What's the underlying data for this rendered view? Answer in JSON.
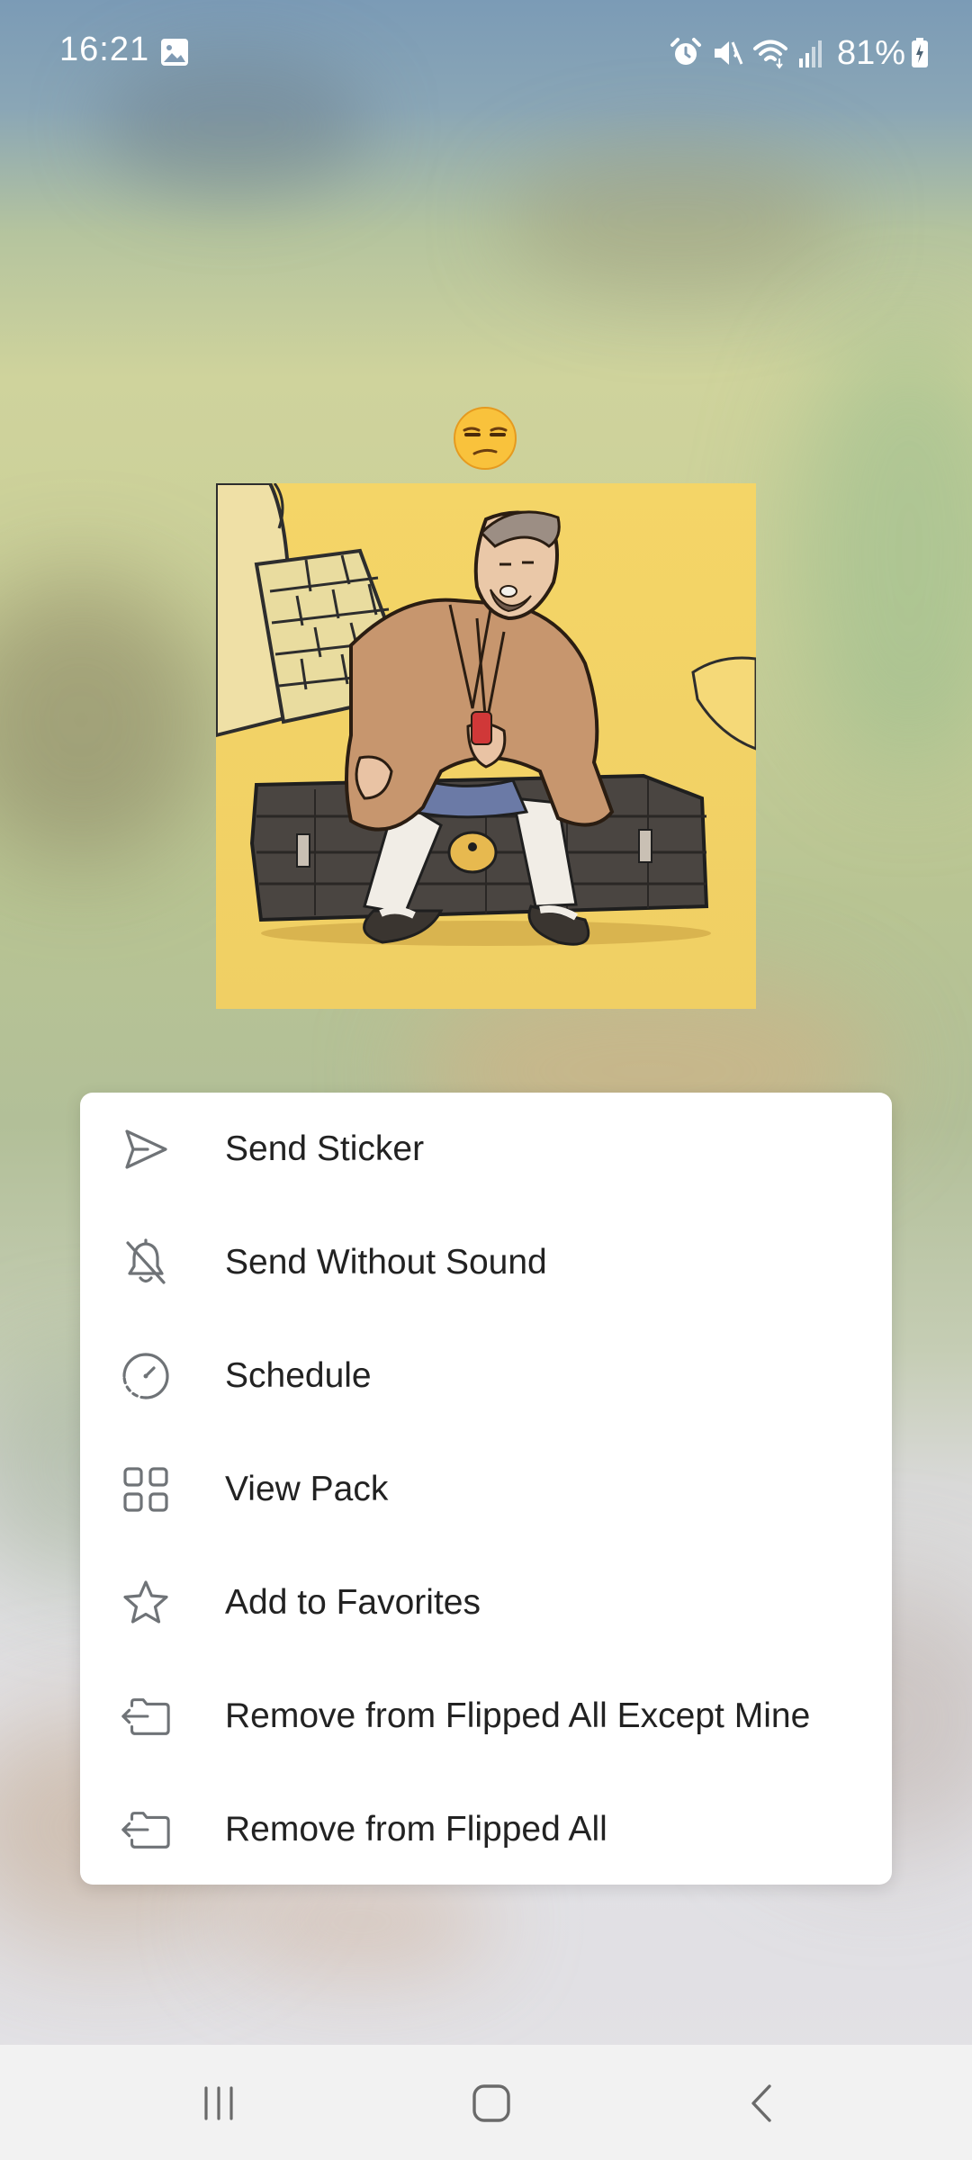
{
  "status_bar": {
    "time": "16:21",
    "battery_percent": "81%",
    "icons": [
      "gallery-icon",
      "alarm-icon",
      "mute-icon",
      "wifi-icon",
      "signal-icon",
      "battery-charging-icon"
    ]
  },
  "sticker": {
    "emoji": "😒",
    "image_icon": "sticker-image"
  },
  "menu": {
    "items": [
      {
        "label": "Send Sticker",
        "icon": "send-icon"
      },
      {
        "label": "Send Without Sound",
        "icon": "bell-off-icon"
      },
      {
        "label": "Schedule",
        "icon": "schedule-icon"
      },
      {
        "label": "View Pack",
        "icon": "grid-icon"
      },
      {
        "label": "Add to Favorites",
        "icon": "star-icon"
      },
      {
        "label": "Remove from Flipped All Except Mine",
        "icon": "remove-folder-icon"
      },
      {
        "label": "Remove from Flipped All",
        "icon": "remove-folder-icon"
      }
    ]
  },
  "nav_bar": {
    "buttons": [
      "recents-icon",
      "home-icon",
      "back-icon"
    ]
  },
  "colors": {
    "menu_background": "#ffffff",
    "menu_text": "#222222",
    "menu_icon": "#6f7377",
    "nav_bar_background": "#f2f2f2"
  }
}
